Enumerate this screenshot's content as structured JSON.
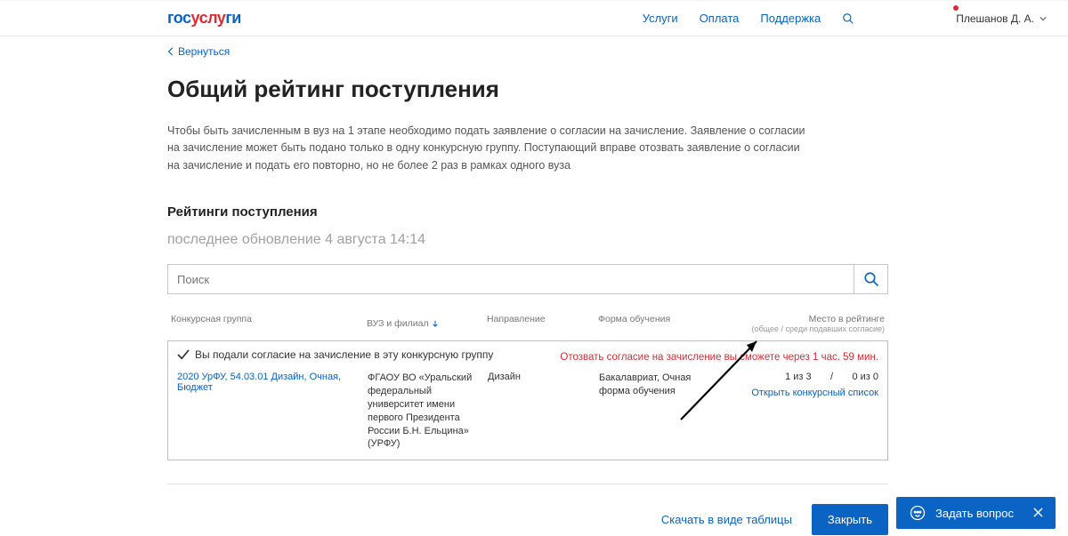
{
  "header": {
    "logo_b1": "гос",
    "logo_r": "услу",
    "logo_b2": "ги",
    "nav": {
      "services": "Услуги",
      "payment": "Оплата",
      "support": "Поддержка"
    },
    "user": "Плешанов Д. А."
  },
  "page": {
    "back": "Вернуться",
    "title": "Общий рейтинг поступления",
    "desc": "Чтобы быть зачисленным в вуз на 1 этапе необходимо подать заявление о согласии на зачисление. Заявление о согласии на зачисление может быть подано только в одну конкурсную группу. Поступающий вправе отозвать заявление о согласии на зачисление и подать его повторно, но не более 2 раз в рамках одного вуза",
    "subheading": "Рейтинги поступления",
    "updated": "последнее обновление 4 августа 14:14",
    "search_placeholder": "Поиск"
  },
  "table": {
    "headers": {
      "group": "Конкурсная группа",
      "vuz": "ВУЗ и филиал",
      "dir": "Направление",
      "form": "Форма обучения",
      "rank": "Место в рейтинге",
      "rank_sub": "(общее / среди подавших согласие)"
    },
    "row": {
      "consent": "Вы подали согласие на зачисление в эту конкурсную группу",
      "warn": "Отозвать согласие на зачисление вы сможете через 1 час. 59 мин.",
      "group": "2020 УрФУ, 54.03.01 Дизайн, Очная, Бюджет",
      "vuz": "ФГАОУ ВО «Уральский федеральный университет имени первого Президента России Б.Н. Ельцина» (УРФУ)",
      "dir": "Дизайн",
      "form": "Бакалавриат, Очная форма обучения",
      "rank": "1 из 3       /       0 из 0",
      "open": "Открыть конкурсный список"
    }
  },
  "footer": {
    "download": "Скачать в виде таблицы",
    "close": "Закрыть"
  },
  "ask": "Задать вопрос"
}
